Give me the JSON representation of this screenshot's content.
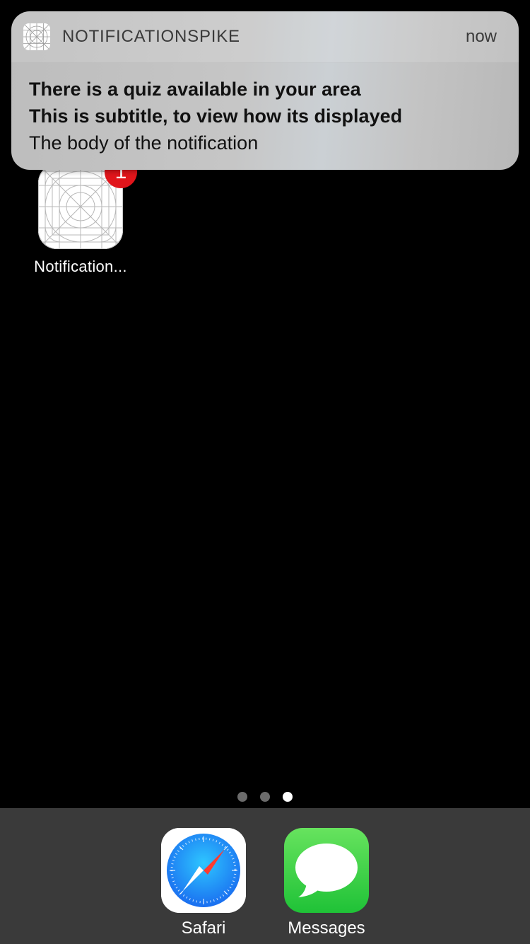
{
  "notification": {
    "app_name": "NOTIFICATIONSPIKE",
    "time": "now",
    "title": "There is a quiz available in your area",
    "subtitle": "This is subtitle, to view how its displayed",
    "body": "The body of the notification",
    "app_icon": "app-grid-icon"
  },
  "home": {
    "app": {
      "label": "Notification...",
      "badge": "1",
      "icon": "app-grid-icon",
      "badge_color": "#e1151b"
    },
    "page_dots": {
      "count": 3,
      "active_index": 2
    }
  },
  "dock": {
    "apps": [
      {
        "label": "Safari",
        "icon": "safari-compass-icon"
      },
      {
        "label": "Messages",
        "icon": "messages-bubble-icon",
        "color": "#34c759"
      }
    ]
  },
  "colors": {
    "background": "#000000",
    "dock": "#3a3a3a",
    "badge": "#e1151b"
  }
}
